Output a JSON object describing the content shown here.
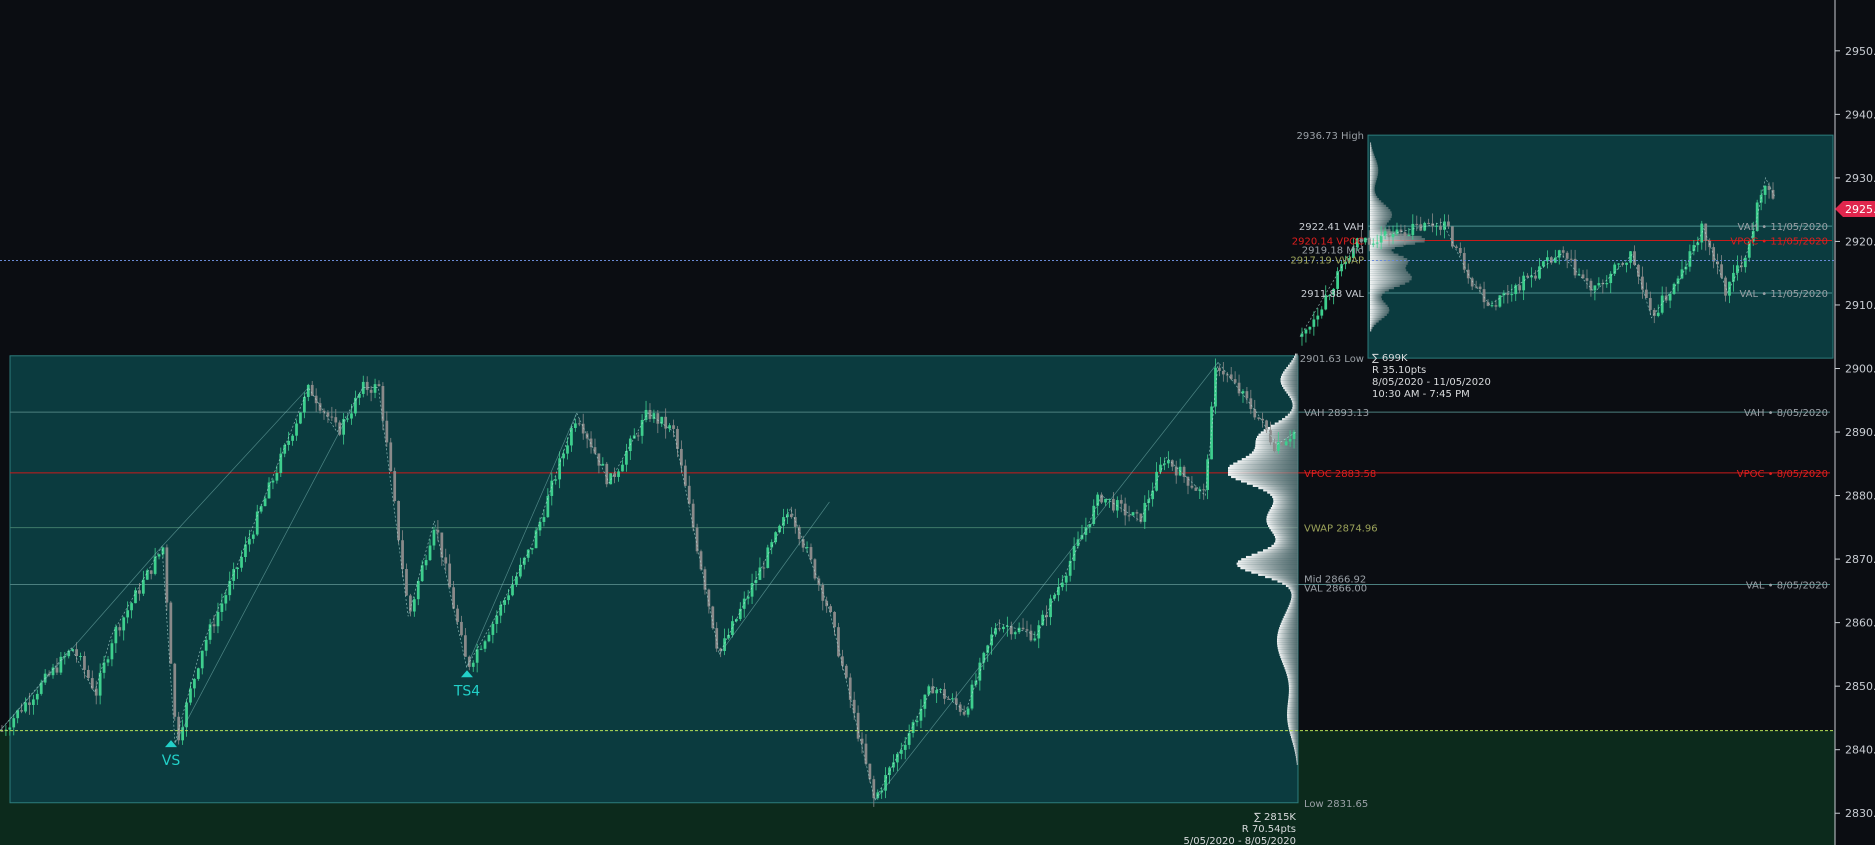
{
  "chart_data": {
    "type": "candlestick-volume-profile",
    "ylim": [
      2825,
      2958
    ],
    "axis": {
      "ticks": [
        2830,
        2840,
        2850,
        2860,
        2870,
        2880,
        2890,
        2900,
        2910,
        2920,
        2930,
        2940,
        2950
      ],
      "tick_labels": [
        "2830.0",
        "2840.0",
        "2850.0",
        "2860.0",
        "2870.0",
        "2880.0",
        "2890.0",
        "2900.0",
        "2910.0",
        "2920.0",
        "2930.0",
        "2940.0",
        "2950.0"
      ],
      "current_price": 2925.1,
      "current_price_label": "2925.1",
      "current_color": "#e0264d"
    },
    "colors": {
      "up": "#3ecf8e",
      "down": "#8a8a8a",
      "profile_bg": "#0b3b3f",
      "vpoc": "#e01e1e",
      "vwap": "#9ca35a",
      "crosshair": "#6b8bd6",
      "fill_below": "#0c2a1c"
    },
    "price_line": 2843.0,
    "crosshair_line": 2917.0,
    "profile1": {
      "high": 2902.0,
      "low": 2831.65,
      "vah": 2893.13,
      "vpoc": 2883.58,
      "vwap": 2874.96,
      "mid": 2866.92,
      "val": 2866.0,
      "label_low": "Low 2831.65",
      "label_vah": "VAH 2893.13",
      "label_vpoc": "VPOC 2883.58",
      "label_vwap": "VWAP 2874.96",
      "label_mid": "Mid 2866.92",
      "label_val": "VAL 2866.00",
      "right_vah": "VAH • 8/05/2020",
      "right_vpoc": "VPOC • 8/05/2020",
      "right_val": "VAL • 8/05/2020",
      "stats": [
        "∑ 2815K",
        "R 70.54pts",
        "5/05/2020 - 8/05/2020"
      ]
    },
    "profile2": {
      "high": 2936.73,
      "low": 2901.63,
      "vah": 2922.41,
      "vpoc": 2920.14,
      "mid": 2919.18,
      "vwap": 2917.19,
      "val": 2911.88,
      "label_high": "2936.73 High",
      "label_vah": "2922.41 VAH",
      "label_vpoc": "2920.14 VPOC",
      "label_mid": "2919.18 Mid",
      "label_vwap": "2917.19 VWAP",
      "label_val": "2911.88 VAL",
      "label_low": "2901.63 Low",
      "right_vah": "VAH • 11/05/2020",
      "right_vpoc": "VPOC • 11/05/2020",
      "right_val": "VAL • 11/05/2020",
      "stats": [
        "∑ 699K",
        "R 35.10pts",
        "8/05/2020 - 11/05/2020",
        "10:30 AM - 7:45 PM"
      ]
    },
    "markers": [
      {
        "text": "VS",
        "price": 2841.5
      },
      {
        "text": "TS4",
        "price": 2852.5
      }
    ],
    "swing_points": [
      [
        0.0,
        2843
      ],
      [
        0.055,
        2856
      ],
      [
        0.073,
        2849
      ],
      [
        0.086,
        2858
      ],
      [
        0.125,
        2872
      ],
      [
        0.135,
        2841
      ],
      [
        0.155,
        2856
      ],
      [
        0.185,
        2870
      ],
      [
        0.238,
        2897
      ],
      [
        0.26,
        2890
      ],
      [
        0.28,
        2897
      ],
      [
        0.292,
        2897
      ],
      [
        0.315,
        2861
      ],
      [
        0.335,
        2876
      ],
      [
        0.36,
        2853
      ],
      [
        0.38,
        2860
      ],
      [
        0.41,
        2872
      ],
      [
        0.445,
        2893
      ],
      [
        0.47,
        2882
      ],
      [
        0.5,
        2893
      ],
      [
        0.52,
        2890
      ],
      [
        0.555,
        2855
      ],
      [
        0.61,
        2878
      ],
      [
        0.64,
        2862
      ],
      [
        0.675,
        2832
      ],
      [
        0.72,
        2850
      ],
      [
        0.745,
        2846
      ],
      [
        0.77,
        2860
      ],
      [
        0.8,
        2858
      ],
      [
        0.85,
        2880
      ],
      [
        0.88,
        2876
      ],
      [
        0.9,
        2886
      ],
      [
        0.93,
        2880
      ],
      [
        0.94,
        2901
      ],
      [
        0.97,
        2893
      ],
      [
        0.985,
        2888
      ],
      [
        1.0,
        2890
      ]
    ],
    "swing_points2": [
      [
        0.0,
        2905
      ],
      [
        0.12,
        2920
      ],
      [
        0.3,
        2923
      ],
      [
        0.36,
        2914
      ],
      [
        0.4,
        2910
      ],
      [
        0.55,
        2918
      ],
      [
        0.62,
        2912
      ],
      [
        0.7,
        2918
      ],
      [
        0.74,
        2908
      ],
      [
        0.8,
        2914
      ],
      [
        0.85,
        2922
      ],
      [
        0.9,
        2912
      ],
      [
        0.94,
        2918
      ],
      [
        0.96,
        2923
      ],
      [
        0.98,
        2930
      ],
      [
        1.0,
        2927
      ]
    ]
  }
}
